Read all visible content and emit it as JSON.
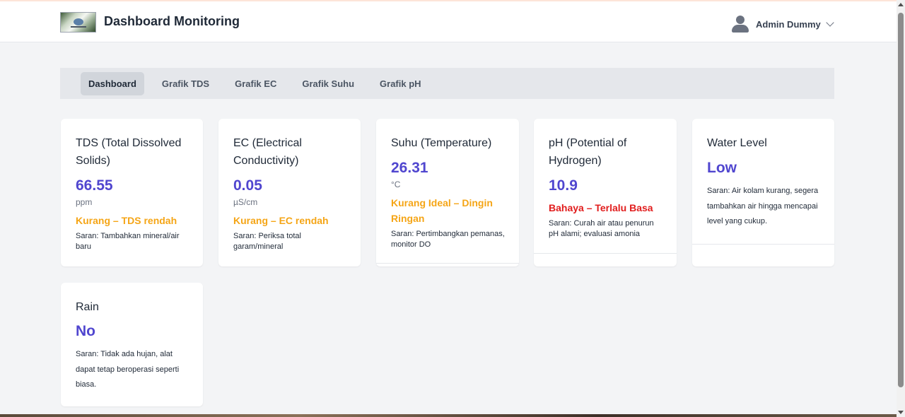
{
  "header": {
    "title": "Dashboard Monitoring",
    "user_name": "Admin Dummy"
  },
  "tabs": [
    {
      "label": "Dashboard",
      "active": true
    },
    {
      "label": "Grafik TDS",
      "active": false
    },
    {
      "label": "Grafik EC",
      "active": false
    },
    {
      "label": "Grafik Suhu",
      "active": false
    },
    {
      "label": "Grafik pH",
      "active": false
    }
  ],
  "cards": {
    "tds": {
      "title": "TDS (Total Dissolved Solids)",
      "value": "66.55",
      "unit": "ppm",
      "status": "Kurang – TDS rendah",
      "status_color": "#f5a516",
      "advice": "Saran: Tambahkan mineral/air baru"
    },
    "ec": {
      "title": "EC (Electrical Conductivity)",
      "value": "0.05",
      "unit": "µS/cm",
      "status": "Kurang – EC rendah",
      "status_color": "#f5a516",
      "advice": "Saran: Periksa total garam/mineral"
    },
    "suhu": {
      "title": "Suhu (Temperature)",
      "value": "26.31",
      "unit": "°C",
      "status": "Kurang Ideal – Dingin Ringan",
      "status_color": "#f5a516",
      "advice": "Saran: Pertimbangkan pemanas, monitor DO"
    },
    "ph": {
      "title": "pH (Potential of Hydrogen)",
      "value": "10.9",
      "status": "Bahaya – Terlalu Basa",
      "status_color": "#e11d1d",
      "advice": "Saran: Curah air atau penurun pH alami; evaluasi amonia"
    },
    "water": {
      "title": "Water Level",
      "value": "Low",
      "advice": "Saran: Air kolam kurang, segera tambahkan air hingga mencapai level yang cukup."
    },
    "rain": {
      "title": "Rain",
      "value": "No",
      "advice": "Saran: Tidak ada hujan, alat dapat tetap beroperasi seperti biasa."
    }
  },
  "colors": {
    "accent": "#5046cf",
    "warning": "#f5a516",
    "danger": "#e11d1d"
  }
}
